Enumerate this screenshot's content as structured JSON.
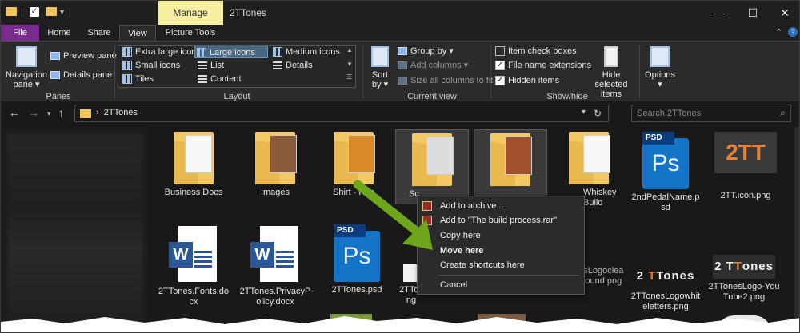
{
  "titlebar": {
    "manage_tab": "Manage",
    "window_title": "2TTones",
    "minimize": "—",
    "maximize": "☐",
    "close": "✕"
  },
  "tabs": {
    "file": "File",
    "home": "Home",
    "share": "Share",
    "view": "View",
    "picture_tools": "Picture Tools",
    "collapse": "⌃",
    "help": "?"
  },
  "ribbon": {
    "panes": {
      "navigation_pane": "Navigation pane",
      "preview_pane": "Preview pane",
      "details_pane": "Details pane",
      "label": "Panes"
    },
    "layout": {
      "extra_large_icons": "Extra large icons",
      "large_icons": "Large icons",
      "medium_icons": "Medium icons",
      "small_icons": "Small icons",
      "list": "List",
      "details": "Details",
      "tiles": "Tiles",
      "content": "Content",
      "label": "Layout"
    },
    "current_view": {
      "sort_by": "Sort by",
      "group_by": "Group by",
      "add_columns": "Add columns",
      "size_all_columns": "Size all columns to fit",
      "label": "Current view"
    },
    "show_hide": {
      "item_check_boxes": "Item check boxes",
      "file_name_extensions": "File name extensions",
      "hidden_items": "Hidden items",
      "item_check_boxes_checked": false,
      "file_name_extensions_checked": true,
      "hidden_items_checked": true,
      "hide_selected_items": "Hide selected items",
      "label": "Show/hide"
    },
    "options": "Options"
  },
  "address": {
    "path": "2TTones",
    "separator": "›",
    "search_placeholder": "Search 2TTones"
  },
  "files": [
    {
      "name": "Business Docs",
      "kind": "folder"
    },
    {
      "name": "Images",
      "kind": "folder"
    },
    {
      "name": "Shirt - Kno",
      "kind": "folder"
    },
    {
      "name": "Sc",
      "kind": "folder"
    },
    {
      "name": "",
      "kind": "folder"
    },
    {
      "name": "Whiskey\nBuild",
      "kind": "folder"
    },
    {
      "name": "2ndPedalName.psd",
      "kind": "psd"
    },
    {
      "name": "2TT.icon.png",
      "kind": "png"
    },
    {
      "name": "2TTones.Fonts.docx",
      "kind": "docx"
    },
    {
      "name": "2TTones.PrivacyPolicy.docx",
      "kind": "docx"
    },
    {
      "name": "2TTones.psd",
      "kind": "psd"
    },
    {
      "name": "2TTonesLogo...\nng",
      "kind": "png"
    },
    {
      "name": "",
      "kind": "png"
    },
    {
      "name": "2TTonesLogoclearbackground.png",
      "kind": "png"
    },
    {
      "name": "2TTonesLogowhiteletters.png",
      "kind": "png"
    },
    {
      "name": "2TTonesLogo-YouTube2.png",
      "kind": "png"
    }
  ],
  "thumb_text": {
    "psd_tag": "PSD",
    "ps": "Ps",
    "word": "W",
    "logo_2tt": "2TT",
    "wordmark_a": "2 ",
    "wordmark_b": "T",
    "wordmark_c": "Tones",
    "wordmark_d": "2 T",
    "wordmark_e": "T",
    "wordmark_f": "ones"
  },
  "context_menu": {
    "add_to_archive": "Add to archive...",
    "add_to_rar": "Add to \"The build process.rar\"",
    "copy_here": "Copy here",
    "move_here": "Move here",
    "create_shortcuts": "Create shortcuts here",
    "cancel": "Cancel"
  },
  "colors": {
    "file_tab": "#7b2a8e",
    "manage_tab": "#f6eea0",
    "arrow": "#6ea51a"
  }
}
